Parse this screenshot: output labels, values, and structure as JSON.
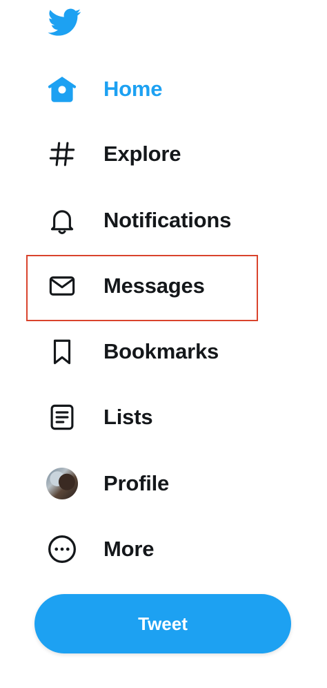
{
  "brand": {
    "icon": "twitter-bird-icon",
    "color": "#1da1f2"
  },
  "nav": {
    "items": [
      {
        "label": "Home",
        "icon": "home-icon",
        "active": true
      },
      {
        "label": "Explore",
        "icon": "hashtag-icon",
        "active": false
      },
      {
        "label": "Notifications",
        "icon": "bell-icon",
        "active": false
      },
      {
        "label": "Messages",
        "icon": "envelope-icon",
        "active": false,
        "highlighted": true
      },
      {
        "label": "Bookmarks",
        "icon": "bookmark-icon",
        "active": false
      },
      {
        "label": "Lists",
        "icon": "list-icon",
        "active": false
      },
      {
        "label": "Profile",
        "icon": "avatar",
        "active": false
      },
      {
        "label": "More",
        "icon": "more-circle-icon",
        "active": false
      }
    ]
  },
  "tweet_button": {
    "label": "Tweet"
  },
  "colors": {
    "accent": "#1da1f2",
    "text": "#14171a",
    "highlight_border": "#d9432c"
  }
}
